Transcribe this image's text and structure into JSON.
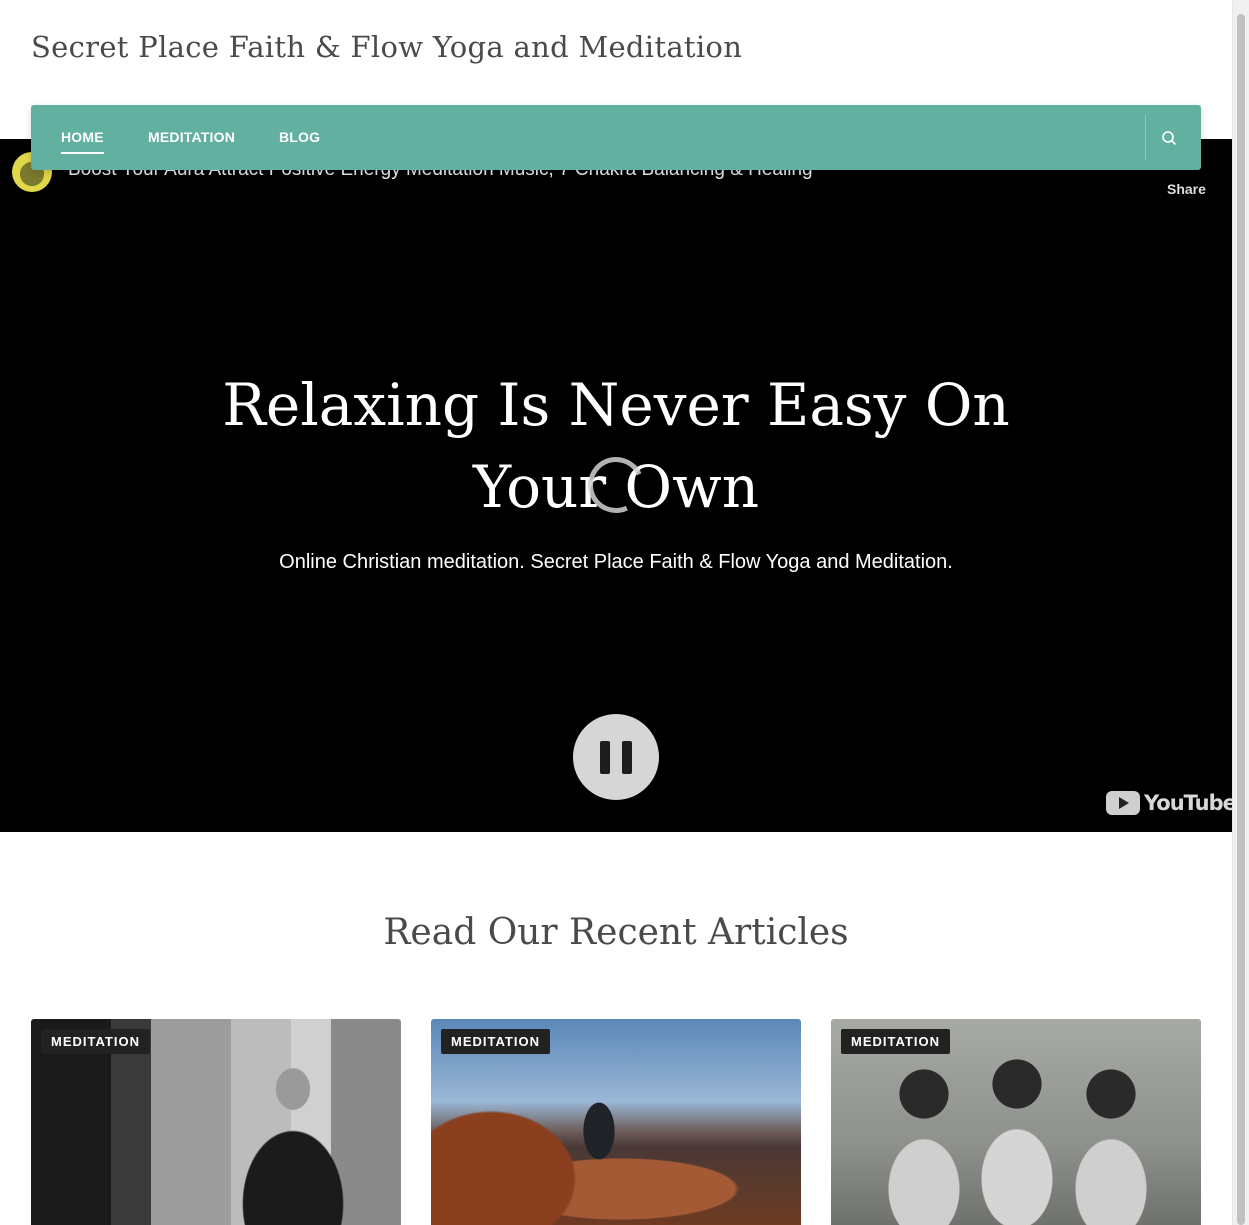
{
  "site": {
    "title": "Secret Place Faith & Flow Yoga and Meditation"
  },
  "nav": {
    "items": [
      {
        "label": "HOME",
        "active": true
      },
      {
        "label": "MEDITATION",
        "active": false
      },
      {
        "label": "BLOG",
        "active": false
      }
    ],
    "search_icon": "search-icon",
    "background_color": "#62b09f"
  },
  "video": {
    "title": "Boost Your Aura  Attract Positive Energy Meditation Music, 7 Chakra Balancing & Healing",
    "share_label": "Share",
    "brand": "YouTube",
    "state": "playing"
  },
  "hero": {
    "heading": "Relaxing Is Never Easy On Your Own",
    "subheading": "Online Christian meditation. Secret Place Faith & Flow Yoga and Meditation."
  },
  "articles": {
    "section_title": "Read Our Recent Articles",
    "cards": [
      {
        "category": "MEDITATION",
        "image": "man-praying-black-and-white"
      },
      {
        "category": "MEDITATION",
        "image": "person-meditating-on-red-rock-cliff"
      },
      {
        "category": "MEDITATION",
        "image": "three-monk-statues-see-hear-speak-no-evil"
      }
    ]
  }
}
